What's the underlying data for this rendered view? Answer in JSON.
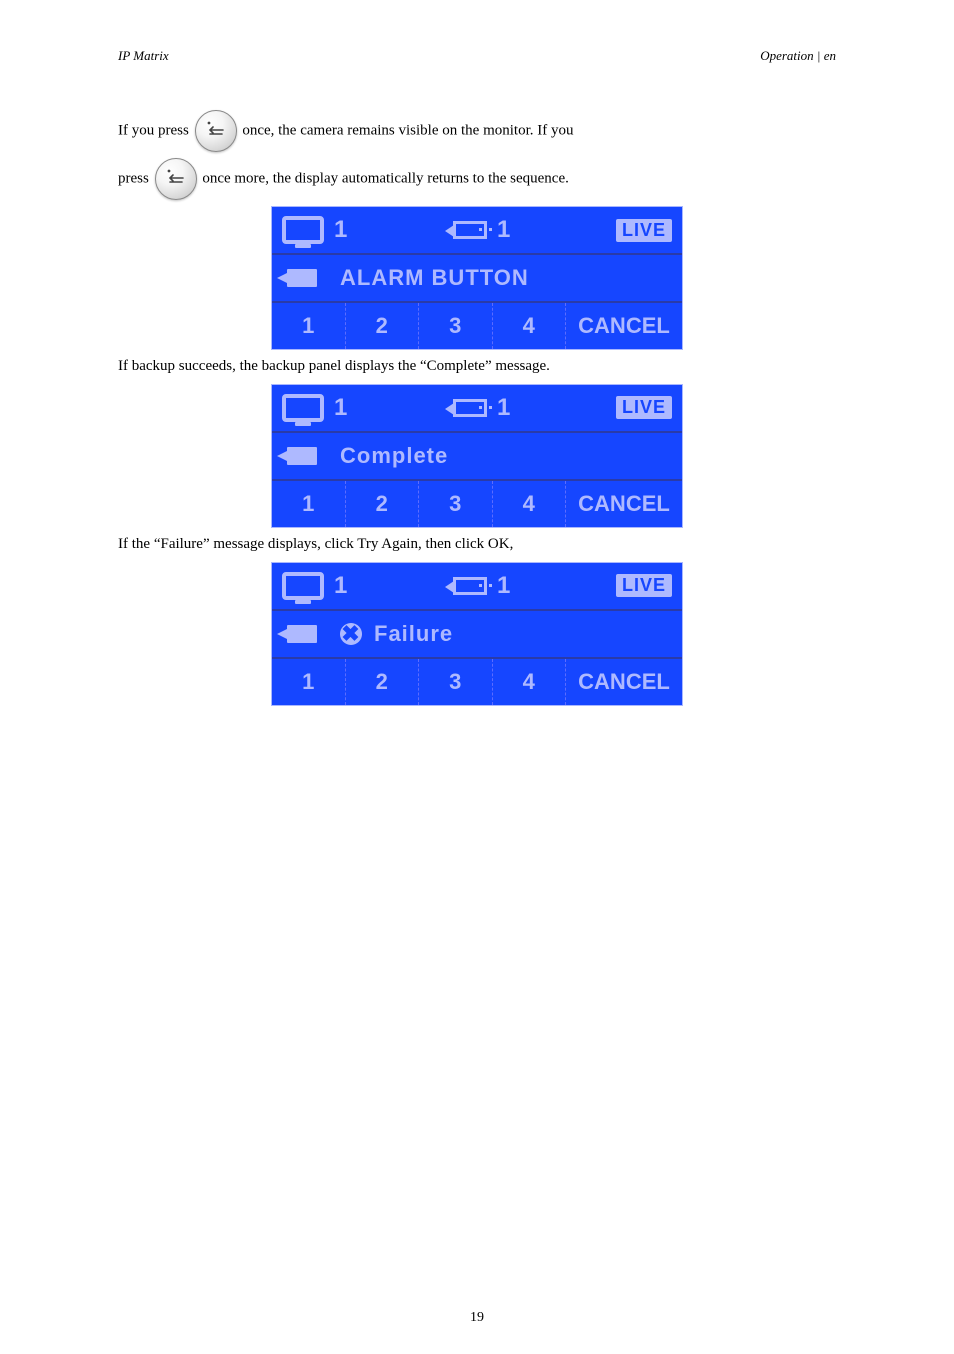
{
  "header": {
    "product": "IP Matrix",
    "section": "Operation | en"
  },
  "pageNumber": "19",
  "paragraphs": {
    "p1_a": "If you press ",
    "p1_b": " once, the camera remains visible on the monitor. If you",
    "p2_a": "press ",
    "p2_b": " once more, the display automatically returns to the sequence.",
    "p3": "If backup succeeds, the backup panel displays the “Complete” message.",
    "p4": "If the “Failure” message displays, click Try Again, then click OK,"
  },
  "panels": [
    {
      "status": "ALARM BUTTON",
      "showX": false
    },
    {
      "status": "Complete",
      "showX": false
    },
    {
      "status": "Failure",
      "showX": true
    }
  ],
  "panelCommon": {
    "monNum": "1",
    "streamNum": "1",
    "live": "LIVE",
    "nums": [
      "1",
      "2",
      "3",
      "4"
    ],
    "cancel": "CANCEL"
  }
}
